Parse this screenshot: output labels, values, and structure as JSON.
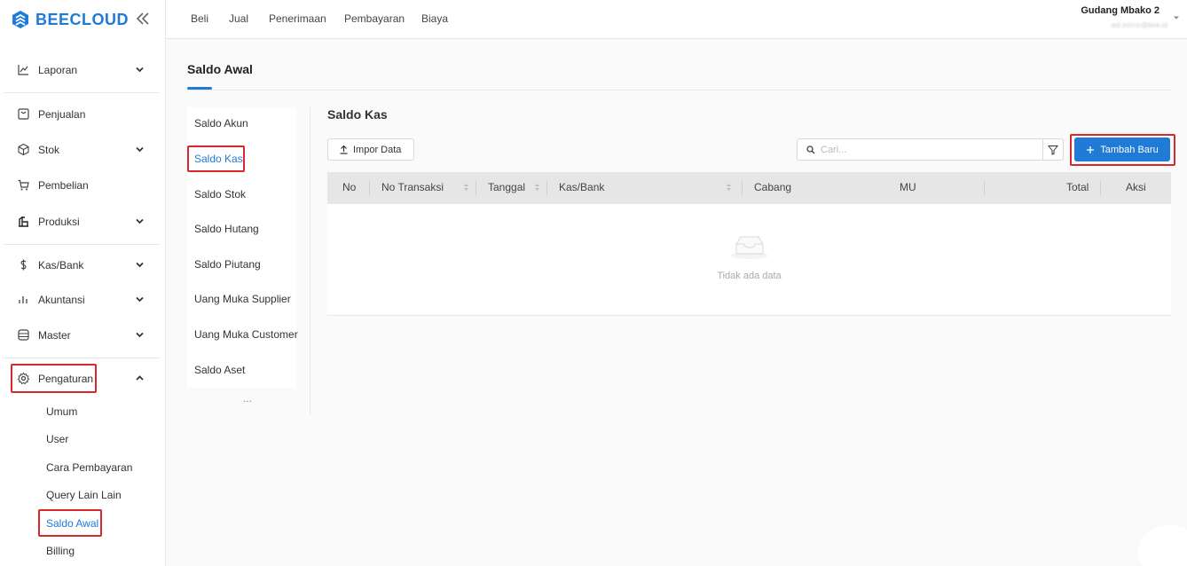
{
  "brand": {
    "name": "BEECLOUD",
    "accent": "#1f7bd6",
    "highlight": "#d9272e"
  },
  "sidebar": {
    "items": [
      {
        "label": "Laporan",
        "icon": "line-chart-icon",
        "has_chevron": true
      },
      {
        "label": "Penjualan",
        "icon": "receipt-icon",
        "has_chevron": false
      },
      {
        "label": "Stok",
        "icon": "box-icon",
        "has_chevron": true
      },
      {
        "label": "Pembelian",
        "icon": "cart-icon",
        "has_chevron": false
      },
      {
        "label": "Produksi",
        "icon": "factory-icon",
        "has_chevron": true
      },
      {
        "label": "Kas/Bank",
        "icon": "dollar-icon",
        "has_chevron": true
      },
      {
        "label": "Akuntansi",
        "icon": "bar-chart-icon",
        "has_chevron": true
      },
      {
        "label": "Master",
        "icon": "database-icon",
        "has_chevron": true
      },
      {
        "label": "Pengaturan",
        "icon": "gear-icon",
        "has_chevron": true,
        "expanded": true
      }
    ],
    "sub_items": [
      "Umum",
      "User",
      "Cara Pembayaran",
      "Query Lain Lain",
      "Saldo Awal",
      "Billing"
    ],
    "active_sub": "Saldo Awal"
  },
  "topbar": {
    "nav": [
      "Beli",
      "Jual",
      "Penerimaan",
      "Pembayaran",
      "Biaya"
    ],
    "user_name": "Gudang Mbako 2",
    "user_email": "adi.mirror@bee.id"
  },
  "page": {
    "title": "Saldo Awal",
    "subnav": [
      "Saldo Akun",
      "Saldo Kas",
      "Saldo Stok",
      "Saldo Hutang",
      "Saldo Piutang",
      "Uang Muka Supplier",
      "Uang Muka Customer",
      "Saldo Aset"
    ],
    "subnav_more": "...",
    "active_subnav": "Saldo Kas",
    "section_title": "Saldo Kas",
    "import_button": "Impor Data",
    "search_placeholder": "Cari...",
    "add_button": "Tambah Baru",
    "table": {
      "columns": [
        "No",
        "No Transaksi",
        "Tanggal",
        "Kas/Bank",
        "Cabang",
        "MU",
        "Total",
        "Aksi"
      ],
      "empty_text": "Tidak ada data"
    }
  }
}
